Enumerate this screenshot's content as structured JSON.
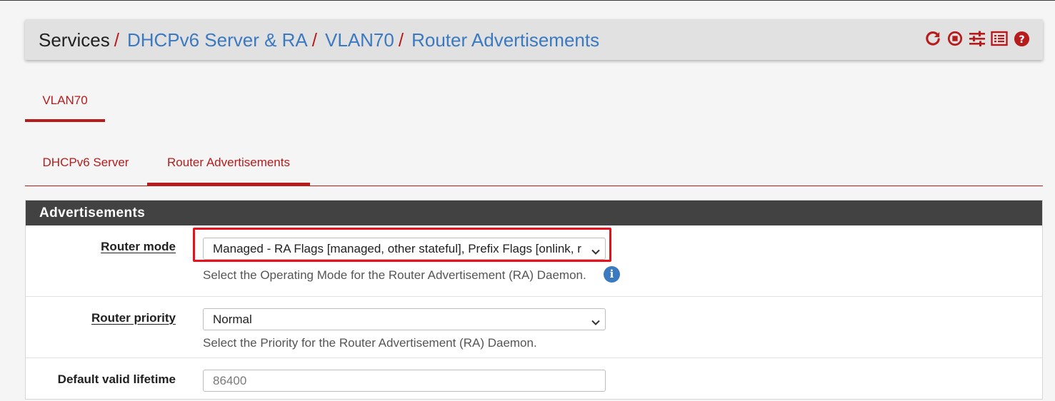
{
  "breadcrumb": {
    "root": "Services",
    "separator": "/",
    "items": [
      "DHCPv6 Server & RA",
      "VLAN70",
      "Router Advertisements"
    ]
  },
  "header_icons": [
    "reload-icon",
    "stop-service-icon",
    "settings-sliders-icon",
    "log-list-icon",
    "help-icon"
  ],
  "colors": {
    "accent": "#b71c1c",
    "link": "#3b79c0",
    "panel_header": "#424242",
    "highlight": "#e8101a"
  },
  "interface_tab": "VLAN70",
  "subtabs": [
    "DHCPv6 Server",
    "Router Advertisements"
  ],
  "panel": {
    "title": "Advertisements",
    "router_mode": {
      "label": "Router mode",
      "value": "Managed - RA Flags [managed, other stateful], Prefix Flags [onlink, r",
      "help": "Select the Operating Mode for the Router Advertisement (RA) Daemon."
    },
    "router_priority": {
      "label": "Router priority",
      "value": "Normal",
      "help": "Select the Priority for the Router Advertisement (RA) Daemon."
    },
    "default_valid_lifetime": {
      "label": "Default valid lifetime",
      "placeholder": "86400"
    }
  }
}
